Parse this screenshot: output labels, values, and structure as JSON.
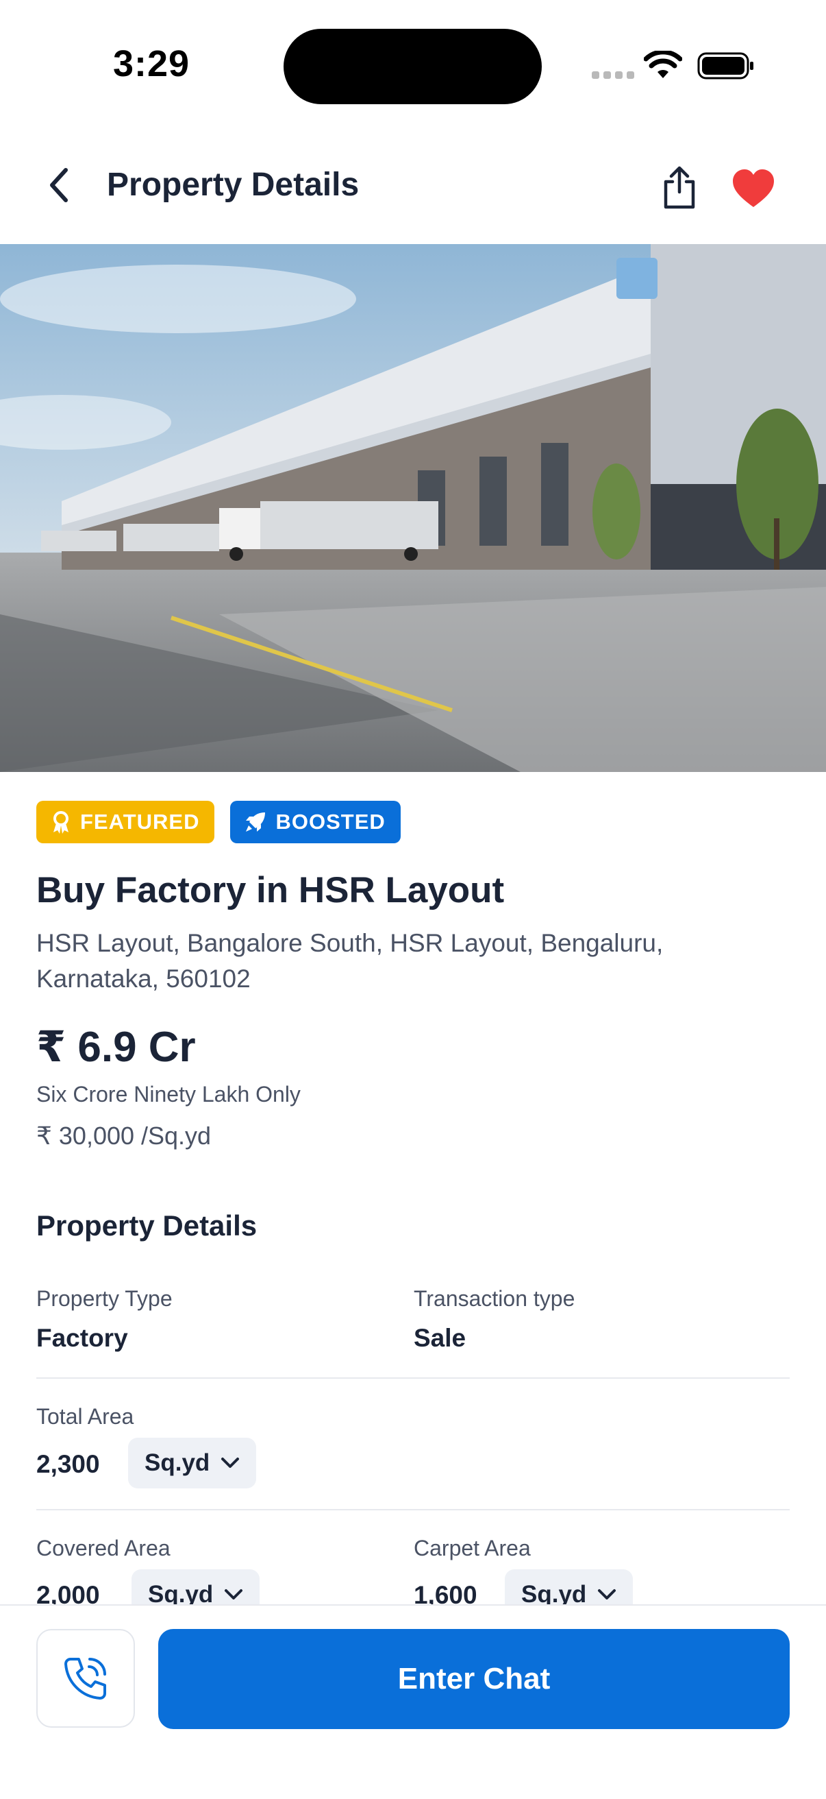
{
  "status_bar": {
    "time": "3:29"
  },
  "header": {
    "title": "Property Details"
  },
  "badges": {
    "featured": "FEATURED",
    "boosted": "BOOSTED"
  },
  "listing": {
    "title": "Buy Factory in HSR Layout",
    "address": "HSR Layout, Bangalore South, HSR Layout, Bengaluru, Karnataka, 560102",
    "price": "₹ 6.9 Cr",
    "price_words": "Six Crore Ninety Lakh Only",
    "price_rate": "₹ 30,000 /Sq.yd"
  },
  "details": {
    "section_title": "Property Details",
    "property_type_label": "Property Type",
    "property_type_value": "Factory",
    "transaction_type_label": "Transaction type",
    "transaction_type_value": "Sale",
    "total_area_label": "Total Area",
    "total_area_value": "2,300",
    "total_area_unit": "Sq.yd",
    "covered_area_label": "Covered Area",
    "covered_area_value": "2,000",
    "covered_area_unit": "Sq.yd",
    "carpet_area_label": "Carpet Area",
    "carpet_area_value": "1,600",
    "carpet_area_unit": "Sq.yd"
  },
  "actions": {
    "chat_label": "Enter Chat"
  },
  "colors": {
    "primary": "#0a6fd9",
    "featured": "#f5b700",
    "favorite": "#f03c3c",
    "text_dark": "#1b2437",
    "text_muted": "#4a5264"
  },
  "icons": [
    "back-chevron-icon",
    "share-icon",
    "heart-icon",
    "award-icon",
    "rocket-icon",
    "chevron-down-icon",
    "phone-icon"
  ]
}
